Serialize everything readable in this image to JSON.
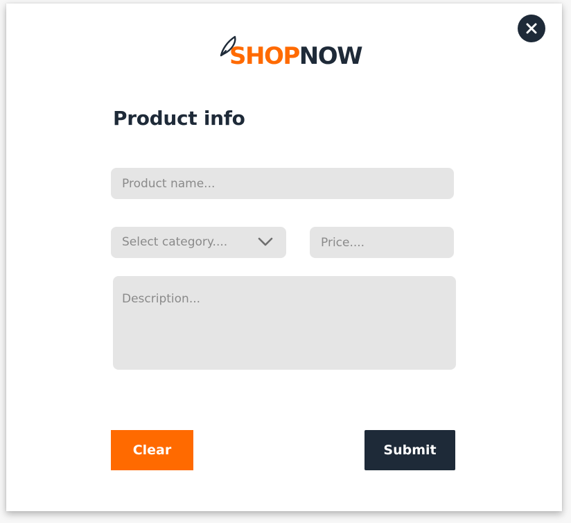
{
  "logo": {
    "part1": "SHOP",
    "part2": "NOW",
    "colors": {
      "shop": "#ff6a00",
      "now": "#1e2a38"
    }
  },
  "close": {
    "icon": "close-icon"
  },
  "form": {
    "title": "Product info",
    "product_name": {
      "placeholder": "Product name..."
    },
    "category": {
      "placeholder": "Select category....",
      "icon": "chevron-down-icon"
    },
    "price": {
      "placeholder": "Price...."
    },
    "description": {
      "placeholder": "Description..."
    }
  },
  "buttons": {
    "clear": "Clear",
    "submit": "Submit"
  },
  "colors": {
    "accent": "#ff6a00",
    "dark": "#1e2a38",
    "field_bg": "#e5e5e5",
    "placeholder": "#8a8a8a"
  }
}
